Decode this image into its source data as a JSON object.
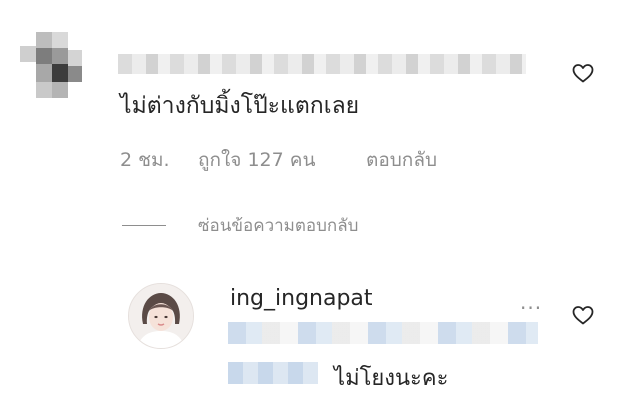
{
  "comment": {
    "text": "ไม่ต่างกับมิ้งโป๊ะแตกเลย",
    "time": "2 ชม.",
    "likes": "ถูกใจ 127 คน",
    "reply_label": "ตอบกลับ",
    "hide_replies_label": "ซ่อนข้อความตอบกลับ"
  },
  "reply": {
    "username": "ing_ingnapat",
    "text": "ไม่โยงนะคะ",
    "more_label": "···"
  },
  "icons": {
    "like": "heart-outline-icon"
  },
  "colors": {
    "primary_text": "#262626",
    "secondary_text": "#8e8e8e"
  }
}
